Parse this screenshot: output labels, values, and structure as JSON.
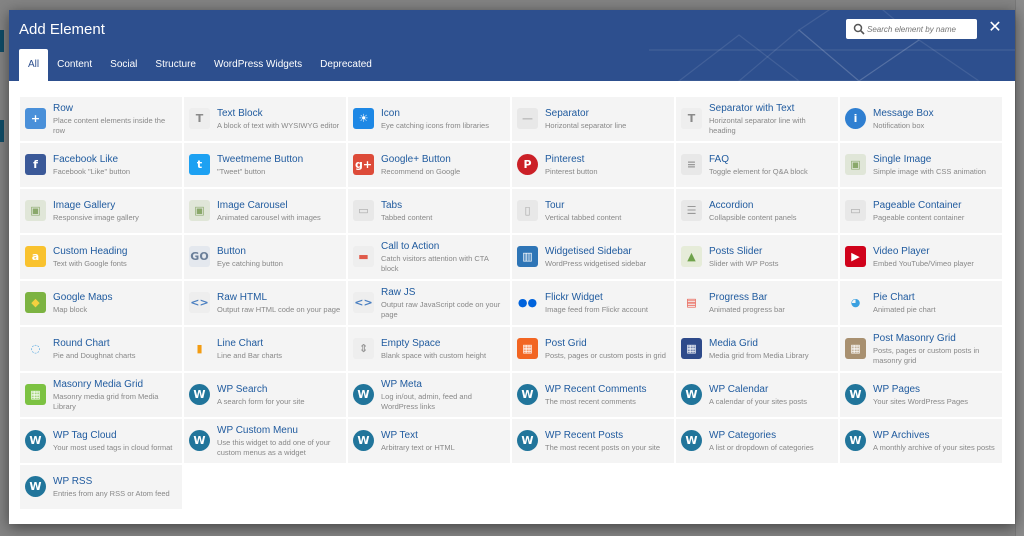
{
  "modal": {
    "title": "Add Element",
    "search_placeholder": "Search element by name",
    "close_label": "✕",
    "tabs": [
      {
        "label": "All",
        "active": true
      },
      {
        "label": "Content",
        "active": false
      },
      {
        "label": "Social",
        "active": false
      },
      {
        "label": "Structure",
        "active": false
      },
      {
        "label": "WordPress Widgets",
        "active": false
      },
      {
        "label": "Deprecated",
        "active": false
      }
    ]
  },
  "colors": {
    "header": "#2d4f8e",
    "element_name": "#1f5a9e",
    "description": "#888888",
    "cell_bg": "#f4f4f4"
  },
  "elements": [
    {
      "name": "Row",
      "desc": "Place content elements inside the row",
      "icon": "plus-icon",
      "bg": "#4a90d9",
      "glyph": "+"
    },
    {
      "name": "Text Block",
      "desc": "A block of text with WYSIWYG editor",
      "icon": "text-block-icon",
      "bg": "#eeeeee",
      "glyph": "T",
      "gc": "#8a8a8a"
    },
    {
      "name": "Icon",
      "desc": "Eye catching icons from libraries",
      "icon": "sun-icon",
      "bg": "#1e88e5",
      "glyph": "☀"
    },
    {
      "name": "Separator",
      "desc": "Horizontal separator line",
      "icon": "separator-icon",
      "bg": "#e8e8e8",
      "glyph": "—",
      "gc": "#bbb"
    },
    {
      "name": "Separator with Text",
      "desc": "Horizontal separator line with heading",
      "icon": "separator-text-icon",
      "bg": "#eeeeee",
      "glyph": "T",
      "gc": "#8a8a8a"
    },
    {
      "name": "Message Box",
      "desc": "Notification box",
      "icon": "info-icon",
      "bg": "#2f7fd1",
      "glyph": "i",
      "round": true
    },
    {
      "name": "Facebook Like",
      "desc": "Facebook \"Like\" button",
      "icon": "facebook-icon",
      "bg": "#3b5998",
      "glyph": "f"
    },
    {
      "name": "Tweetmeme Button",
      "desc": "\"Tweet\" button",
      "icon": "twitter-icon",
      "bg": "#1da1f2",
      "glyph": "t"
    },
    {
      "name": "Google+ Button",
      "desc": "Recommend on Google",
      "icon": "google-plus-icon",
      "bg": "#dd4b39",
      "glyph": "g+"
    },
    {
      "name": "Pinterest",
      "desc": "Pinterest button",
      "icon": "pinterest-icon",
      "bg": "#cb2027",
      "glyph": "P",
      "round": true
    },
    {
      "name": "FAQ",
      "desc": "Toggle element for Q&A block",
      "icon": "faq-icon",
      "bg": "#e8e8e8",
      "glyph": "≡",
      "gc": "#999"
    },
    {
      "name": "Single Image",
      "desc": "Simple image with CSS animation",
      "icon": "image-icon",
      "bg": "#e0e6d8",
      "glyph": "▣",
      "gc": "#8aa86b"
    },
    {
      "name": "Image Gallery",
      "desc": "Responsive image gallery",
      "icon": "image-gallery-icon",
      "bg": "#e0e6d8",
      "glyph": "▣",
      "gc": "#8aa86b"
    },
    {
      "name": "Image Carousel",
      "desc": "Animated carousel with images",
      "icon": "image-carousel-icon",
      "bg": "#e0e6d8",
      "glyph": "▣",
      "gc": "#8aa86b"
    },
    {
      "name": "Tabs",
      "desc": "Tabbed content",
      "icon": "tabs-icon",
      "bg": "#e8e8e8",
      "glyph": "▭",
      "gc": "#aaa"
    },
    {
      "name": "Tour",
      "desc": "Vertical tabbed content",
      "icon": "tour-icon",
      "bg": "#e8e8e8",
      "glyph": "▯",
      "gc": "#aaa"
    },
    {
      "name": "Accordion",
      "desc": "Collapsible content panels",
      "icon": "accordion-icon",
      "bg": "#e8e8e8",
      "glyph": "☰",
      "gc": "#999"
    },
    {
      "name": "Pageable Container",
      "desc": "Pageable content container",
      "icon": "pageable-icon",
      "bg": "#e8e8e8",
      "glyph": "▭",
      "gc": "#aaa"
    },
    {
      "name": "Custom Heading",
      "desc": "Text with Google fonts",
      "icon": "heading-icon",
      "bg": "#f9c22e",
      "glyph": "a"
    },
    {
      "name": "Button",
      "desc": "Eye catching button",
      "icon": "button-icon",
      "bg": "#e4e8ee",
      "glyph": "GO",
      "gc": "#6b7f99"
    },
    {
      "name": "Call to Action",
      "desc": "Catch visitors attention with CTA block",
      "icon": "cta-icon",
      "bg": "#eeeeee",
      "glyph": "▬",
      "gc": "#e05a4b"
    },
    {
      "name": "Widgetised Sidebar",
      "desc": "WordPress widgetised sidebar",
      "icon": "sidebar-icon",
      "bg": "#2e75b6",
      "glyph": "▥"
    },
    {
      "name": "Posts Slider",
      "desc": "Slider with WP Posts",
      "icon": "posts-slider-icon",
      "bg": "#e6ecd9",
      "glyph": "▲",
      "gc": "#6fa24b"
    },
    {
      "name": "Video Player",
      "desc": "Embed YouTube/Vimeo player",
      "icon": "video-icon",
      "bg": "#d0021b",
      "glyph": "▶"
    },
    {
      "name": "Google Maps",
      "desc": "Map block",
      "icon": "map-icon",
      "bg": "#7cb342",
      "glyph": "◆",
      "gc": "#f4d03f"
    },
    {
      "name": "Raw HTML",
      "desc": "Output raw HTML code on your page",
      "icon": "raw-html-icon",
      "bg": "#eeeeee",
      "glyph": "<>",
      "gc": "#4a7fc1"
    },
    {
      "name": "Raw JS",
      "desc": "Output raw JavaScript code on your page",
      "icon": "raw-js-icon",
      "bg": "#eeeeee",
      "glyph": "<>",
      "gc": "#4a7fc1"
    },
    {
      "name": "Flickr Widget",
      "desc": "Image feed from Flickr account",
      "icon": "flickr-icon",
      "bg": "#f4f4f4",
      "glyph": "●●",
      "gc": "#0063dc"
    },
    {
      "name": "Progress Bar",
      "desc": "Animated progress bar",
      "icon": "progress-bar-icon",
      "bg": "#f4f4f4",
      "glyph": "▤",
      "gc": "#e74c3c"
    },
    {
      "name": "Pie Chart",
      "desc": "Animated pie chart",
      "icon": "pie-chart-icon",
      "bg": "#f4f4f4",
      "glyph": "◕",
      "gc": "#3aa0e0"
    },
    {
      "name": "Round Chart",
      "desc": "Pie and Doughnat charts",
      "icon": "round-chart-icon",
      "bg": "#f4f4f4",
      "glyph": "◌",
      "gc": "#4aa3df"
    },
    {
      "name": "Line Chart",
      "desc": "Line and Bar charts",
      "icon": "line-chart-icon",
      "bg": "#f4f4f4",
      "glyph": "▮",
      "gc": "#f39c12"
    },
    {
      "name": "Empty Space",
      "desc": "Blank space with custom height",
      "icon": "empty-space-icon",
      "bg": "#eeeeee",
      "glyph": "⇕",
      "gc": "#999"
    },
    {
      "name": "Post Grid",
      "desc": "Posts, pages or custom posts in grid",
      "icon": "post-grid-icon",
      "bg": "#f26522",
      "glyph": "▦"
    },
    {
      "name": "Media Grid",
      "desc": "Media grid from Media Library",
      "icon": "media-grid-icon",
      "bg": "#2e4a8a",
      "glyph": "▦"
    },
    {
      "name": "Post Masonry Grid",
      "desc": "Posts, pages or custom posts in masonry grid",
      "icon": "masonry-grid-icon",
      "bg": "#a89070",
      "glyph": "▦"
    },
    {
      "name": "Masonry Media Grid",
      "desc": "Masonry media grid from Media Library",
      "icon": "masonry-media-icon",
      "bg": "#7cc242",
      "glyph": "▦"
    },
    {
      "name": "WP Search",
      "desc": "A search form for your site",
      "icon": "wordpress-icon",
      "bg": "#21759b",
      "glyph": "W",
      "round": true
    },
    {
      "name": "WP Meta",
      "desc": "Log in/out, admin, feed and WordPress links",
      "icon": "wordpress-icon",
      "bg": "#21759b",
      "glyph": "W",
      "round": true
    },
    {
      "name": "WP Recent Comments",
      "desc": "The most recent comments",
      "icon": "wordpress-icon",
      "bg": "#21759b",
      "glyph": "W",
      "round": true
    },
    {
      "name": "WP Calendar",
      "desc": "A calendar of your sites posts",
      "icon": "wordpress-icon",
      "bg": "#21759b",
      "glyph": "W",
      "round": true
    },
    {
      "name": "WP Pages",
      "desc": "Your sites WordPress Pages",
      "icon": "wordpress-icon",
      "bg": "#21759b",
      "glyph": "W",
      "round": true
    },
    {
      "name": "WP Tag Cloud",
      "desc": "Your most used tags in cloud format",
      "icon": "wordpress-icon",
      "bg": "#21759b",
      "glyph": "W",
      "round": true
    },
    {
      "name": "WP Custom Menu",
      "desc": "Use this widget to add one of your custom menus as a widget",
      "icon": "wordpress-icon",
      "bg": "#21759b",
      "glyph": "W",
      "round": true
    },
    {
      "name": "WP Text",
      "desc": "Arbitrary text or HTML",
      "icon": "wordpress-icon",
      "bg": "#21759b",
      "glyph": "W",
      "round": true
    },
    {
      "name": "WP Recent Posts",
      "desc": "The most recent posts on your site",
      "icon": "wordpress-icon",
      "bg": "#21759b",
      "glyph": "W",
      "round": true
    },
    {
      "name": "WP Categories",
      "desc": "A list or dropdown of categories",
      "icon": "wordpress-icon",
      "bg": "#21759b",
      "glyph": "W",
      "round": true
    },
    {
      "name": "WP Archives",
      "desc": "A monthly archive of your sites posts",
      "icon": "wordpress-icon",
      "bg": "#21759b",
      "glyph": "W",
      "round": true
    },
    {
      "name": "WP RSS",
      "desc": "Entries from any RSS or Atom feed",
      "icon": "wordpress-icon",
      "bg": "#21759b",
      "glyph": "W",
      "round": true
    }
  ]
}
